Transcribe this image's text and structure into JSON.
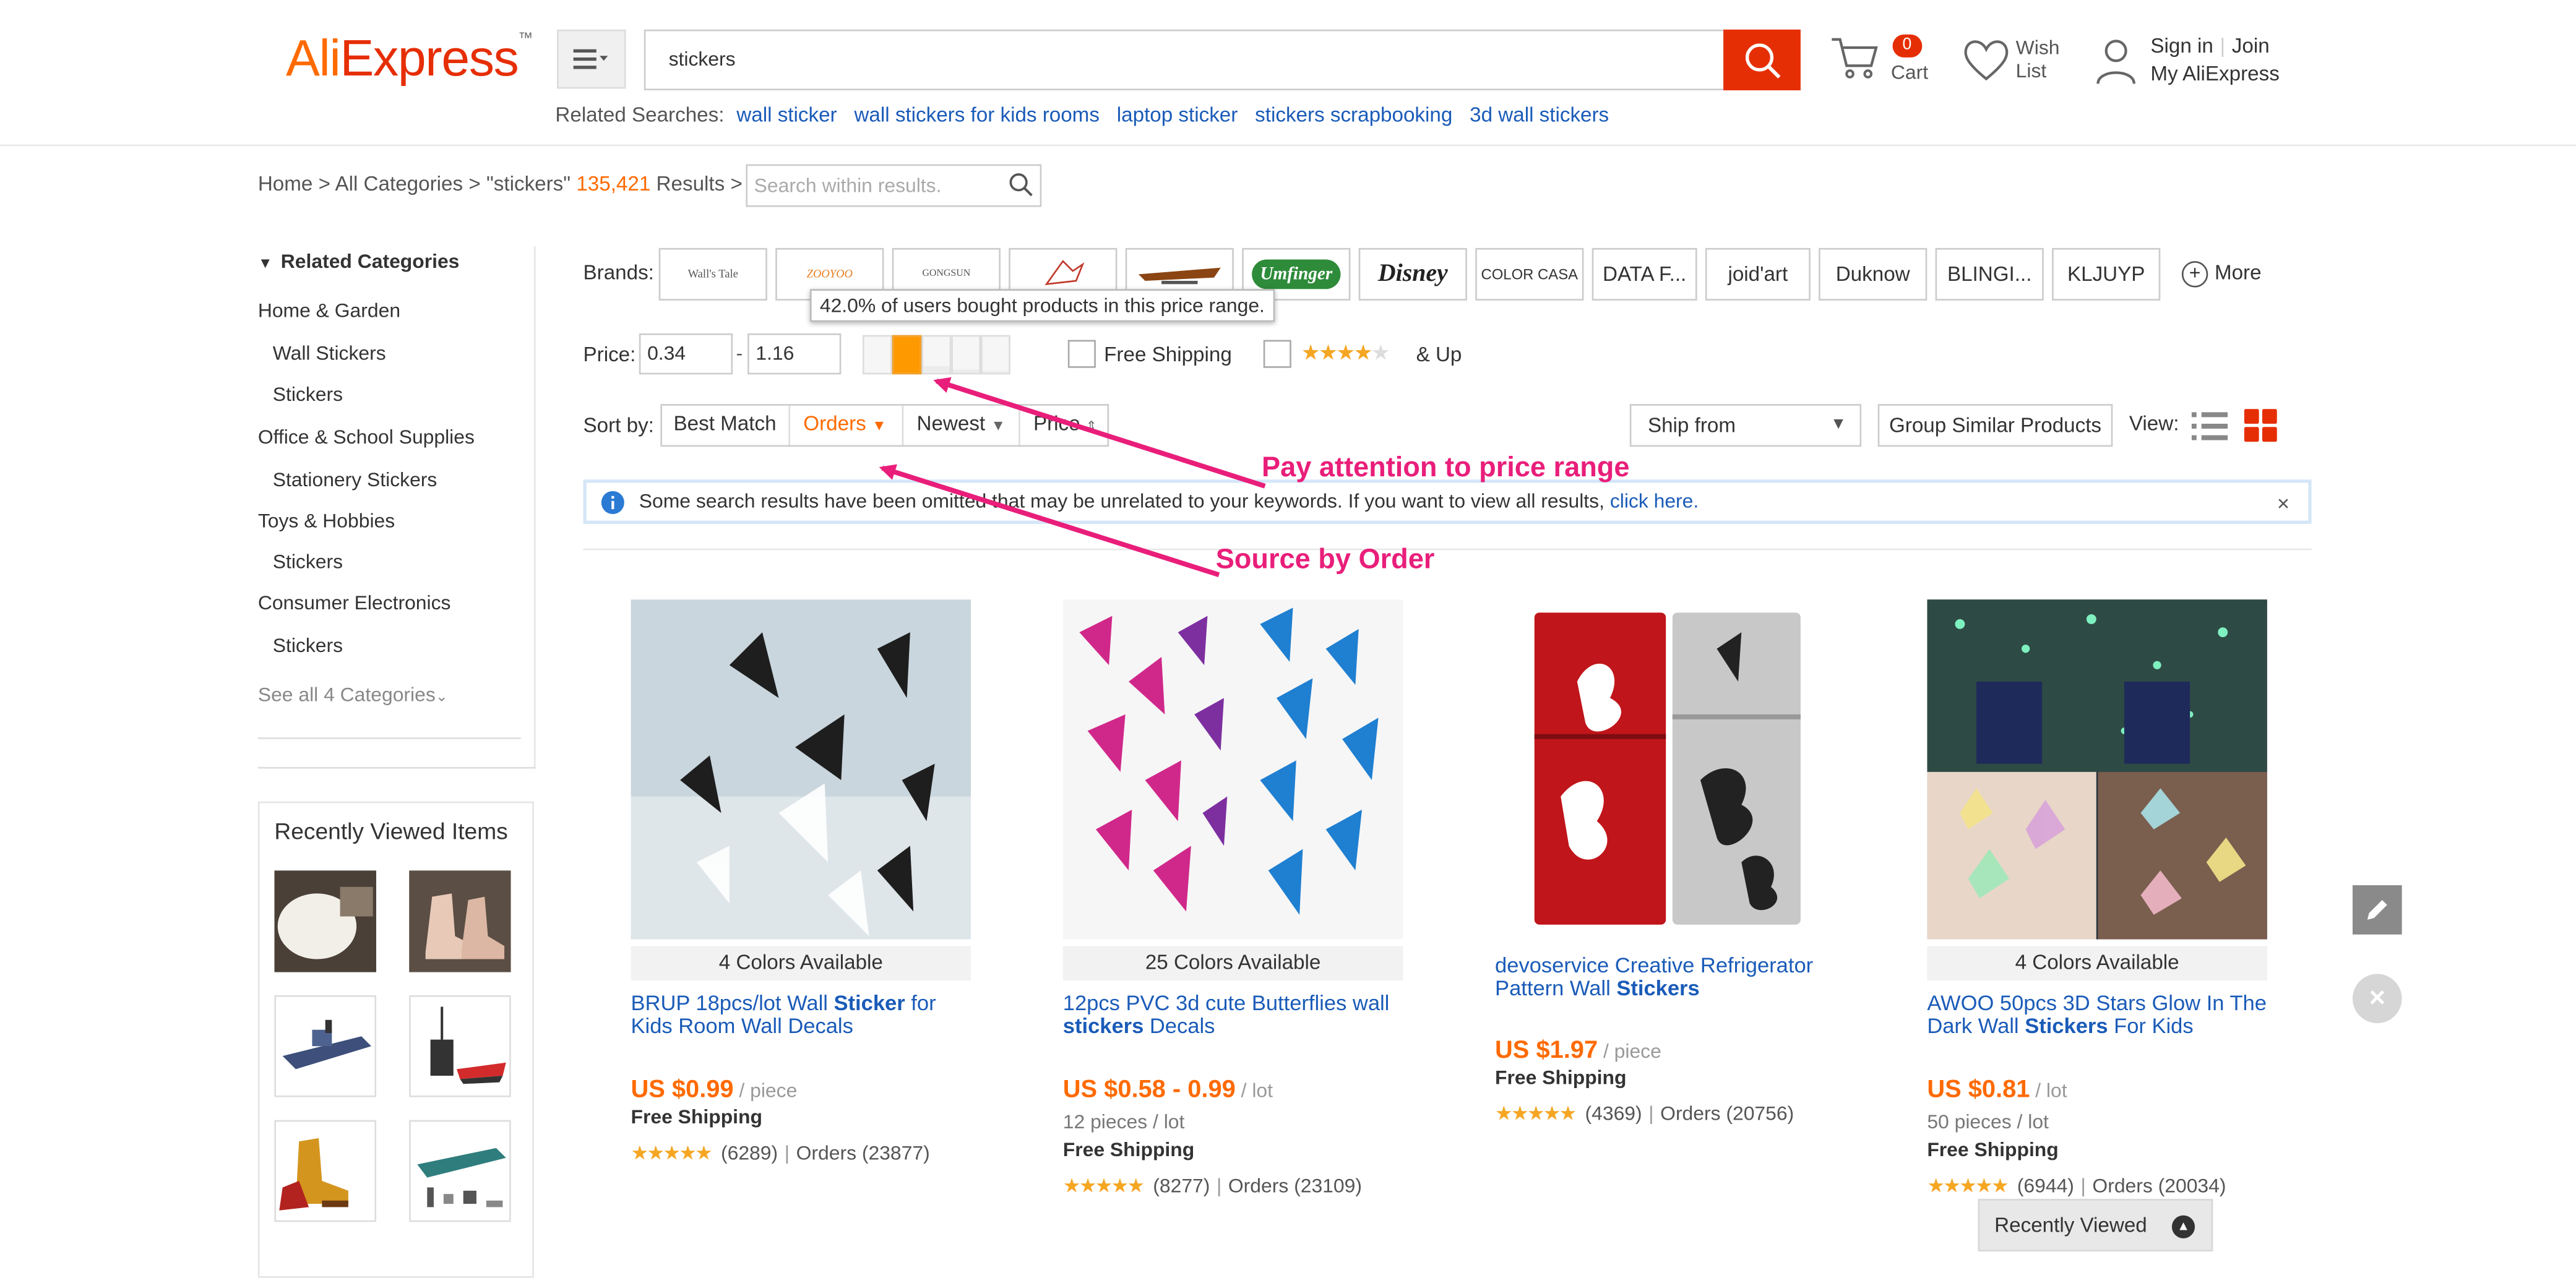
{
  "header": {
    "logo_main": "Ali",
    "logo_rest": "Express",
    "logo_tm": "™",
    "search_value": "stickers",
    "related_label": "Related Searches:",
    "related_searches": [
      "wall sticker",
      "wall stickers for kids rooms",
      "laptop sticker",
      "stickers scrapbooking",
      "3d wall stickers"
    ],
    "cart_count": "0",
    "cart_label": "Cart",
    "wish_label_1": "Wish",
    "wish_label_2": "List",
    "signin": "Sign in",
    "join": "Join",
    "my_account": "My AliExpress"
  },
  "breadcrumb": {
    "home": "Home",
    "sep": ">",
    "all_categories": "All Categories",
    "query": "\"stickers\"",
    "count": "135,421",
    "results": "Results",
    "within_placeholder": "Search within results."
  },
  "sidebar": {
    "related_title": "Related Categories",
    "categories": [
      {
        "label": "Home & Garden",
        "sub": false
      },
      {
        "label": "Wall Stickers",
        "sub": true
      },
      {
        "label": "Stickers",
        "sub": true
      },
      {
        "label": "Office & School Supplies",
        "sub": false
      },
      {
        "label": "Stationery Stickers",
        "sub": true
      },
      {
        "label": "Toys & Hobbies",
        "sub": false
      },
      {
        "label": "Stickers",
        "sub": true
      },
      {
        "label": "Consumer Electronics",
        "sub": false
      },
      {
        "label": "Stickers",
        "sub": true
      }
    ],
    "see_all": "See all 4 Categories",
    "recent_title": "Recently Viewed Items"
  },
  "filters": {
    "brands_label": "Brands:",
    "brands": [
      "Wall's Tale",
      "ZOOYOO",
      "GONGSUN",
      "",
      "",
      "Umfinger",
      "Disney",
      "COLOR CASA",
      "DATA F...",
      "joid'art",
      "Duknow",
      "BLINGI...",
      "KLJUYP"
    ],
    "more": "More",
    "tooltip": "42.0% of users bought products in this price range.",
    "price_label": "Price:",
    "price_min": "0.34",
    "price_max": "1.16",
    "price_dash": "-",
    "price_histogram": [
      0,
      0.42,
      0.2,
      0.1,
      0.05
    ],
    "free_shipping": "Free Shipping",
    "rating_stars": "★★★★",
    "rating_gray": "★",
    "and_up": "& Up",
    "sort_label": "Sort by:",
    "sort_best": "Best Match",
    "sort_orders": "Orders",
    "sort_newest": "Newest",
    "sort_price": "Price",
    "ship_from": "Ship from",
    "group_similar": "Group Similar Products",
    "view_label": "View:"
  },
  "notice": {
    "text": "Some search results have been omitted that may be unrelated to your keywords. If you want to view all results,",
    "link": "click here.",
    "close": "×"
  },
  "annotations": {
    "price": "Pay attention to price range",
    "order": "Source by Order"
  },
  "products": [
    {
      "colors": "4 Colors Available",
      "title_pre": "BRUP 18pcs/lot Wall ",
      "title_bold": "Sticker",
      "title_post": " for Kids Room Wall Decals",
      "price": "US $0.99",
      "unit": " / piece",
      "pieces": "",
      "shipping": "Free Shipping",
      "stars": "★★★★★",
      "reviews": "(6289)",
      "orders": "Orders (23877)"
    },
    {
      "colors": "25 Colors Available",
      "title_pre": "12pcs PVC 3d cute Butterflies wall ",
      "title_bold": "stickers",
      "title_post": " Decals",
      "price": "US $0.58 - 0.99",
      "unit": " / lot",
      "pieces": "12 pieces / lot",
      "shipping": "Free Shipping",
      "stars": "★★★★★",
      "reviews": "(8277)",
      "orders": "Orders (23109)"
    },
    {
      "colors": "",
      "title_pre": "devoservice Creative Refrigerator Pattern Wall ",
      "title_bold": "Stickers",
      "title_post": "",
      "price": "US $1.97",
      "unit": " / piece",
      "pieces": "",
      "shipping": "Free Shipping",
      "stars": "★★★★★",
      "reviews": "(4369)",
      "orders": "Orders (20756)"
    },
    {
      "colors": "4 Colors Available",
      "title_pre": "AWOO 50pcs 3D Stars Glow In The Dark Wall ",
      "title_bold": "Stickers",
      "title_post": " For Kids",
      "price": "US $0.81",
      "unit": " / lot",
      "pieces": "50 pieces / lot",
      "shipping": "Free Shipping",
      "stars": "★★★★★",
      "reviews": "(6944)",
      "orders": "Orders (20034)"
    }
  ],
  "floating": {
    "recently_viewed": "Recently Viewed",
    "close": "×"
  },
  "icons": [
    "menu-icon",
    "search-icon",
    "cart-icon",
    "heart-icon",
    "user-icon",
    "info-icon",
    "list-view-icon",
    "grid-view-icon",
    "pencil-icon",
    "close-icon",
    "chevron-up-icon"
  ],
  "colors": {
    "brand_red": "#e62e04",
    "accent_orange": "#ff6a00",
    "link_blue": "#1a5bb8",
    "annotation_pink": "#e91e7a"
  }
}
